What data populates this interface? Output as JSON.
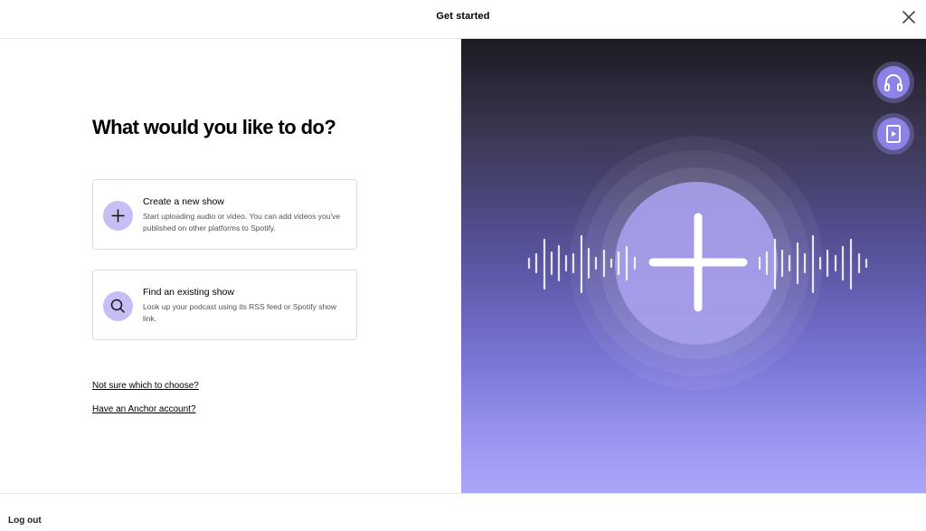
{
  "header": {
    "title": "Get started",
    "close_icon": "close-icon"
  },
  "main": {
    "heading": "What would you like to do?",
    "options": [
      {
        "title": "Create a new show",
        "description": "Start uploading audio or video. You can add videos you've published on other platforms to Spotify.",
        "icon": "plus-icon"
      },
      {
        "title": "Find an existing show",
        "description": "Look up your podcast using its RSS feed or Spotify show link.",
        "icon": "search-icon"
      }
    ],
    "links": {
      "not_sure": "Not sure which to choose?",
      "anchor": "Have an Anchor account?"
    }
  },
  "illustration": {
    "side_buttons": [
      "headphones-icon",
      "video-play-icon"
    ],
    "center_icon": "plus-icon"
  },
  "footer": {
    "logout": "Log out"
  },
  "colors": {
    "accent_circle": "#c6bff5",
    "gradient_top": "#1c1a22",
    "gradient_bottom": "#aaa6f6"
  }
}
